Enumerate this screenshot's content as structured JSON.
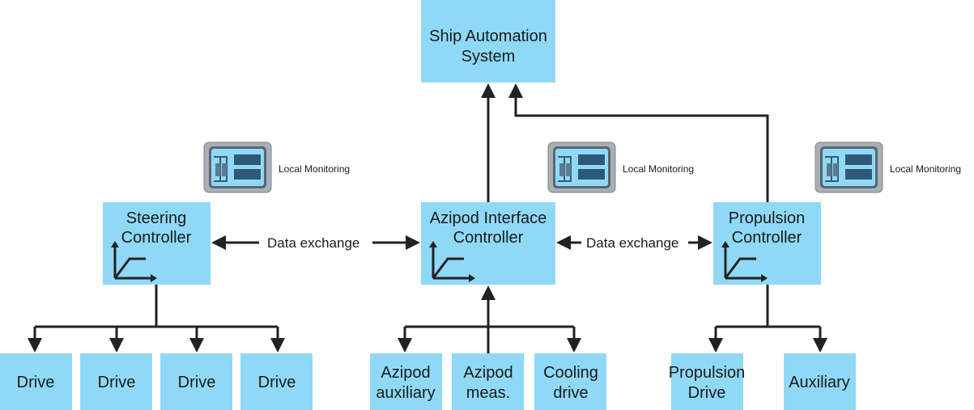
{
  "nodes": {
    "ship_automation": [
      "Ship Automation",
      "System"
    ],
    "steering": [
      "Steering",
      "Controller"
    ],
    "azipod_interface": [
      "Azipod Interface",
      "Controller"
    ],
    "propulsion": [
      "Propulsion",
      "Controller"
    ],
    "drives": [
      "Drive",
      "Drive",
      "Drive",
      "Drive"
    ],
    "azipod_auxiliary": [
      "Azipod",
      "auxiliary"
    ],
    "azipod_meas": [
      "Azipod",
      "meas."
    ],
    "cooling_drive": [
      "Cooling",
      "drive"
    ],
    "propulsion_drive": [
      "Propulsion",
      "Drive"
    ],
    "auxiliary": "Auxiliary"
  },
  "labels": {
    "local_monitoring": [
      "Local Monitoring",
      "Local Monitoring",
      "Local Monitoring"
    ],
    "data_exchange": [
      "Data exchange",
      "Data exchange"
    ]
  },
  "colors": {
    "box": "#8fd9f7",
    "line": "#222222"
  }
}
